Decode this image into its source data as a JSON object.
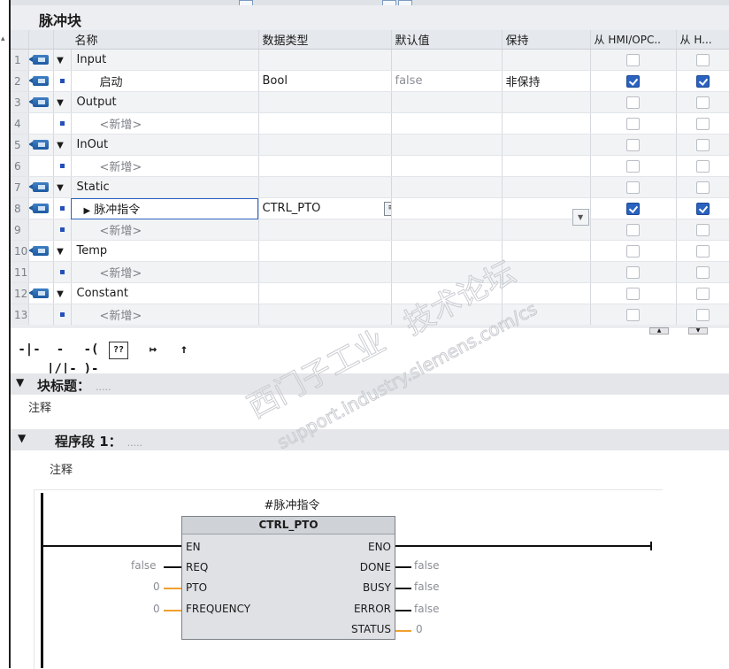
{
  "block": {
    "title": "脉冲块"
  },
  "columns": {
    "name": "名称",
    "datatype": "数据类型",
    "default": "默认值",
    "retain": "保持",
    "hmi_opc": "从 HMI/OPC..",
    "hmi": "从 H..."
  },
  "rows": [
    {
      "num": "1",
      "name": "Input",
      "kind": "section",
      "datatype": "",
      "default": "",
      "retain": "",
      "hmi_opc": false,
      "hmi": false
    },
    {
      "num": "2",
      "name": "启动",
      "kind": "var",
      "datatype": "Bool",
      "default": "false",
      "retain": "非保持",
      "hmi_opc": true,
      "hmi": true
    },
    {
      "num": "3",
      "name": "Output",
      "kind": "section",
      "datatype": "",
      "default": "",
      "retain": "",
      "hmi_opc": false,
      "hmi": false
    },
    {
      "num": "4",
      "name": "<新增>",
      "kind": "add",
      "datatype": "",
      "default": "",
      "retain": "",
      "hmi_opc": false,
      "hmi": false
    },
    {
      "num": "5",
      "name": "InOut",
      "kind": "section",
      "datatype": "",
      "default": "",
      "retain": "",
      "hmi_opc": false,
      "hmi": false
    },
    {
      "num": "6",
      "name": "<新增>",
      "kind": "add",
      "datatype": "",
      "default": "",
      "retain": "",
      "hmi_opc": false,
      "hmi": false
    },
    {
      "num": "7",
      "name": "Static",
      "kind": "section",
      "datatype": "",
      "default": "",
      "retain": "",
      "hmi_opc": false,
      "hmi": false
    },
    {
      "num": "8",
      "name": "脉冲指令",
      "kind": "struct",
      "datatype": "CTRL_PTO",
      "default": "",
      "retain": "",
      "hmi_opc": true,
      "hmi": true
    },
    {
      "num": "9",
      "name": "<新增>",
      "kind": "add",
      "datatype": "",
      "default": "",
      "retain": "",
      "hmi_opc": false,
      "hmi": false
    },
    {
      "num": "10",
      "name": "Temp",
      "kind": "section",
      "datatype": "",
      "default": "",
      "retain": "",
      "hmi_opc": false,
      "hmi": false
    },
    {
      "num": "11",
      "name": "<新增>",
      "kind": "add",
      "datatype": "",
      "default": "",
      "retain": "",
      "hmi_opc": false,
      "hmi": false
    },
    {
      "num": "12",
      "name": "Constant",
      "kind": "section",
      "datatype": "",
      "default": "",
      "retain": "",
      "hmi_opc": false,
      "hmi": false
    },
    {
      "num": "13",
      "name": "<新增>",
      "kind": "add",
      "datatype": "",
      "default": "",
      "retain": "",
      "hmi_opc": false,
      "hmi": false
    }
  ],
  "toolbar": [
    {
      "name": "no-contact-button",
      "label": "-|-"
    },
    {
      "name": "nc-contact-button",
      "label": "-|/|-"
    },
    {
      "name": "coil-button",
      "label": "-( )-"
    },
    {
      "name": "empty-box-button",
      "label": "??"
    },
    {
      "name": "open-branch-button",
      "label": "↦"
    },
    {
      "name": "close-branch-button",
      "label": "↑"
    }
  ],
  "block_title": {
    "label": "块标题：",
    "dots": "....."
  },
  "block_comment": "注释",
  "network": {
    "label": "程序段 1：",
    "dots": ".....",
    "comment": "注释"
  },
  "fb": {
    "instance": "#脉冲指令",
    "type": "CTRL_PTO",
    "in": [
      "EN",
      "REQ",
      "PTO",
      "FREQUENCY"
    ],
    "out": [
      "ENO",
      "DONE",
      "BUSY",
      "ERROR",
      "STATUS"
    ],
    "req_val": "false",
    "pto_val": "0",
    "freq_val": "0",
    "done_val": "false",
    "busy_val": "false",
    "error_val": "false",
    "status_val": "0"
  },
  "watermark": [
    "西门子工业",
    "技术论坛",
    "support.industry.siemens.com/cs"
  ]
}
